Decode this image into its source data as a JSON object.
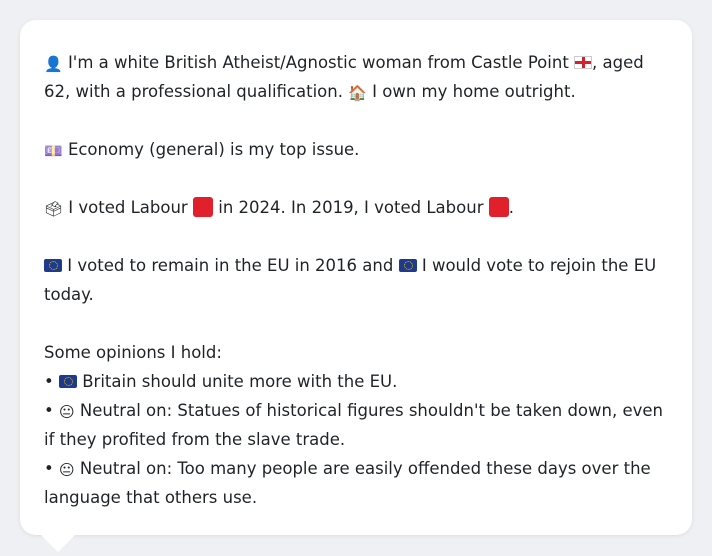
{
  "profile": {
    "line1_a": "I'm a white British Atheist/Agnostic woman from Castle Point",
    "line1_b": ", aged 62, with a professional qualification.",
    "line1_c": "I own my home outright."
  },
  "issue": {
    "text": "Economy (general) is my top issue."
  },
  "vote": {
    "part1": "I voted Labour",
    "part2": "in 2024. In 2019, I voted Labour",
    "part3": "."
  },
  "eu": {
    "part1": "I voted to remain in the EU in 2016 and",
    "part2": "I would vote to rejoin the EU today."
  },
  "opinions": {
    "heading": "Some opinions I hold:",
    "items": [
      {
        "bullet": "•",
        "text": "Britain should unite more with the EU."
      },
      {
        "bullet": "•",
        "text": "Neutral on: Statues of historical figures shouldn't be taken down, even if they profited from the slave trade."
      },
      {
        "bullet": "•",
        "text": "Neutral on: Too many people are easily offended these days over the language that others use."
      }
    ]
  },
  "icons": {
    "person": "person-silhouette-icon",
    "england_flag": "england-flag-icon",
    "house": "house-icon",
    "money": "banknote-icon",
    "ballot": "ballot-box-icon",
    "labour": "red-square-icon",
    "eu_flag": "eu-flag-icon",
    "neutral": "neutral-face-icon"
  },
  "colors": {
    "labour_red": "#e0202a",
    "eu_blue": "#1e3a8a",
    "card_bg": "#ffffff",
    "page_bg": "#eef0f3",
    "text": "#1f2328"
  }
}
